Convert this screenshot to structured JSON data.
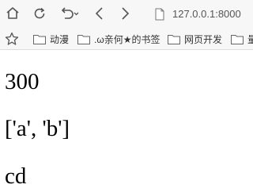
{
  "browser": {
    "address": "127.0.0.1:8000",
    "icons": [
      "home-icon",
      "reload-icon",
      "undo-icon",
      "back-icon",
      "forward-icon",
      "page-icon"
    ]
  },
  "bookmarks": {
    "items": [
      {
        "label": "动漫"
      },
      {
        "label": ".ω亲何★的书签"
      },
      {
        "label": "网页开发"
      },
      {
        "label": "量"
      }
    ]
  },
  "page": {
    "lines": [
      "300",
      "['a', 'b']",
      "cd"
    ]
  }
}
